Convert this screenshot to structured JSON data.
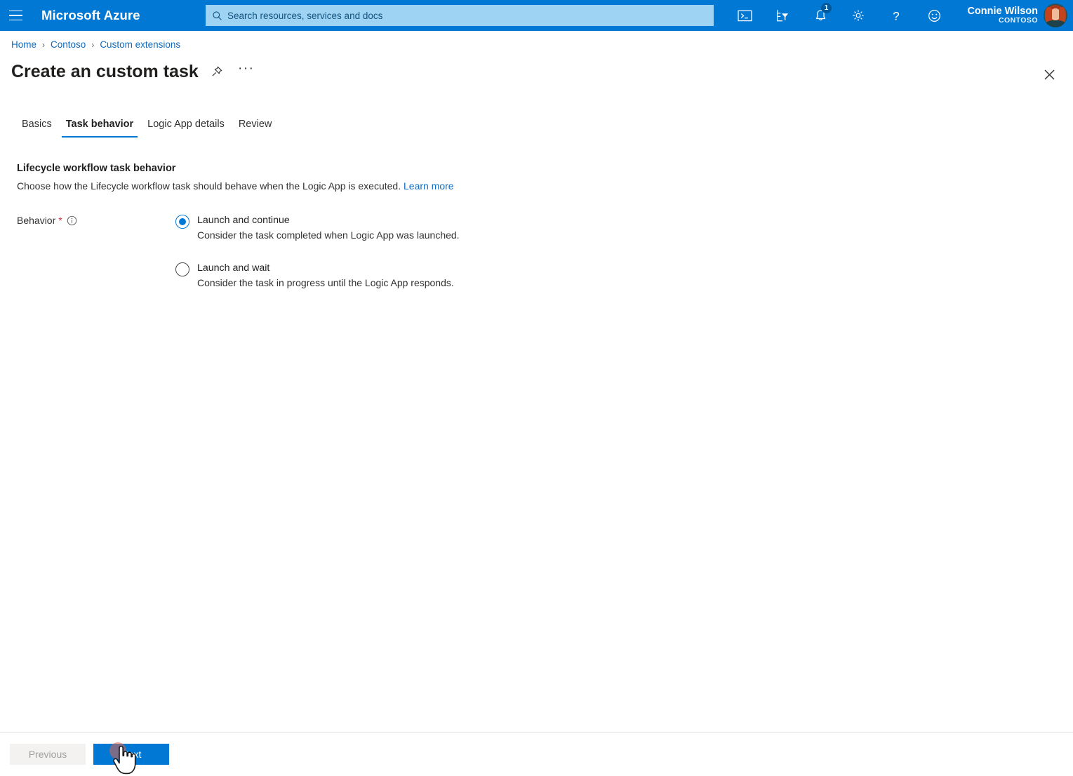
{
  "topbar": {
    "menu_icon": "hamburger-icon",
    "brand": "Microsoft Azure",
    "search": {
      "placeholder": "Search resources, services and docs",
      "value": "",
      "icon": "search-icon"
    },
    "icons": [
      {
        "name": "cloud-shell-icon",
        "label": "Cloud Shell"
      },
      {
        "name": "directory-filter-icon",
        "label": "Directories + subscriptions"
      },
      {
        "name": "notifications-bell-icon",
        "label": "Notifications",
        "badge": "1"
      },
      {
        "name": "settings-gear-icon",
        "label": "Settings"
      },
      {
        "name": "help-question-icon",
        "label": "Help"
      },
      {
        "name": "feedback-smiley-icon",
        "label": "Feedback"
      }
    ],
    "account": {
      "user_name": "Connie Wilson",
      "tenant": "CONTOSO",
      "avatar": "user-avatar"
    },
    "background_color": "#0078d4",
    "search_background_color": "#9ed3f3"
  },
  "breadcrumb": {
    "items": [
      "Home",
      "Contoso",
      "Custom extensions"
    ],
    "separator": "›",
    "link_color": "#0f6cbd"
  },
  "page": {
    "title": "Create an custom task",
    "pin_icon": "pin-icon",
    "more_icon": "ellipsis-icon",
    "more_label": "···",
    "close_icon": "close-icon"
  },
  "tabs": [
    {
      "label": "Basics",
      "active": false
    },
    {
      "label": "Task behavior",
      "active": true
    },
    {
      "label": "Logic App details",
      "active": false
    },
    {
      "label": "Review",
      "active": false
    }
  ],
  "content": {
    "section_heading": "Lifecycle workflow task behavior",
    "section_desc": "Choose how the Lifecycle workflow task should behave when the Logic App is executed.",
    "learn_more": "Learn more",
    "field": {
      "label": "Behavior",
      "required_marker": "*",
      "info_icon": "info-icon"
    },
    "options": [
      {
        "title": "Launch and continue",
        "description": "Consider the task completed when Logic App was launched.",
        "selected": true
      },
      {
        "title": "Launch and wait",
        "description": "Consider the task in progress until the Logic App responds.",
        "selected": false
      }
    ],
    "accent_color": "#0078d4",
    "required_color": "#cf2c41"
  },
  "footer": {
    "previous_label": "Previous",
    "previous_disabled": true,
    "next_label": "Next",
    "next_color": "#0078d4"
  },
  "cursor": {
    "type": "pointing-hand",
    "click_highlight_color": "#e06248"
  }
}
